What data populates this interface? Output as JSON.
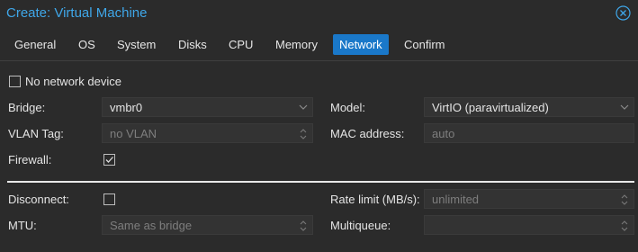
{
  "window": {
    "title": "Create: Virtual Machine",
    "close_icon": "close-circle-icon"
  },
  "tabs": [
    {
      "label": "General"
    },
    {
      "label": "OS"
    },
    {
      "label": "System"
    },
    {
      "label": "Disks"
    },
    {
      "label": "CPU"
    },
    {
      "label": "Memory"
    },
    {
      "label": "Network",
      "active": true
    },
    {
      "label": "Confirm"
    }
  ],
  "form": {
    "no_network_device": {
      "label": "No network device",
      "checked": false
    },
    "bridge": {
      "label": "Bridge:",
      "value": "vmbr0"
    },
    "model": {
      "label": "Model:",
      "value": "VirtIO (paravirtualized)"
    },
    "vlan_tag": {
      "label": "VLAN Tag:",
      "placeholder": "no VLAN"
    },
    "mac_address": {
      "label": "MAC address:",
      "placeholder": "auto"
    },
    "firewall": {
      "label": "Firewall:",
      "checked": true
    },
    "disconnect": {
      "label": "Disconnect:",
      "checked": false
    },
    "rate_limit": {
      "label": "Rate limit (MB/s):",
      "placeholder": "unlimited"
    },
    "mtu": {
      "label": "MTU:",
      "placeholder": "Same as bridge"
    },
    "multiqueue": {
      "label": "Multiqueue:",
      "placeholder": ""
    }
  },
  "colors": {
    "accent": "#3fa7e9",
    "active_tab": "#1a78c9",
    "background": "#2b2b2b"
  }
}
